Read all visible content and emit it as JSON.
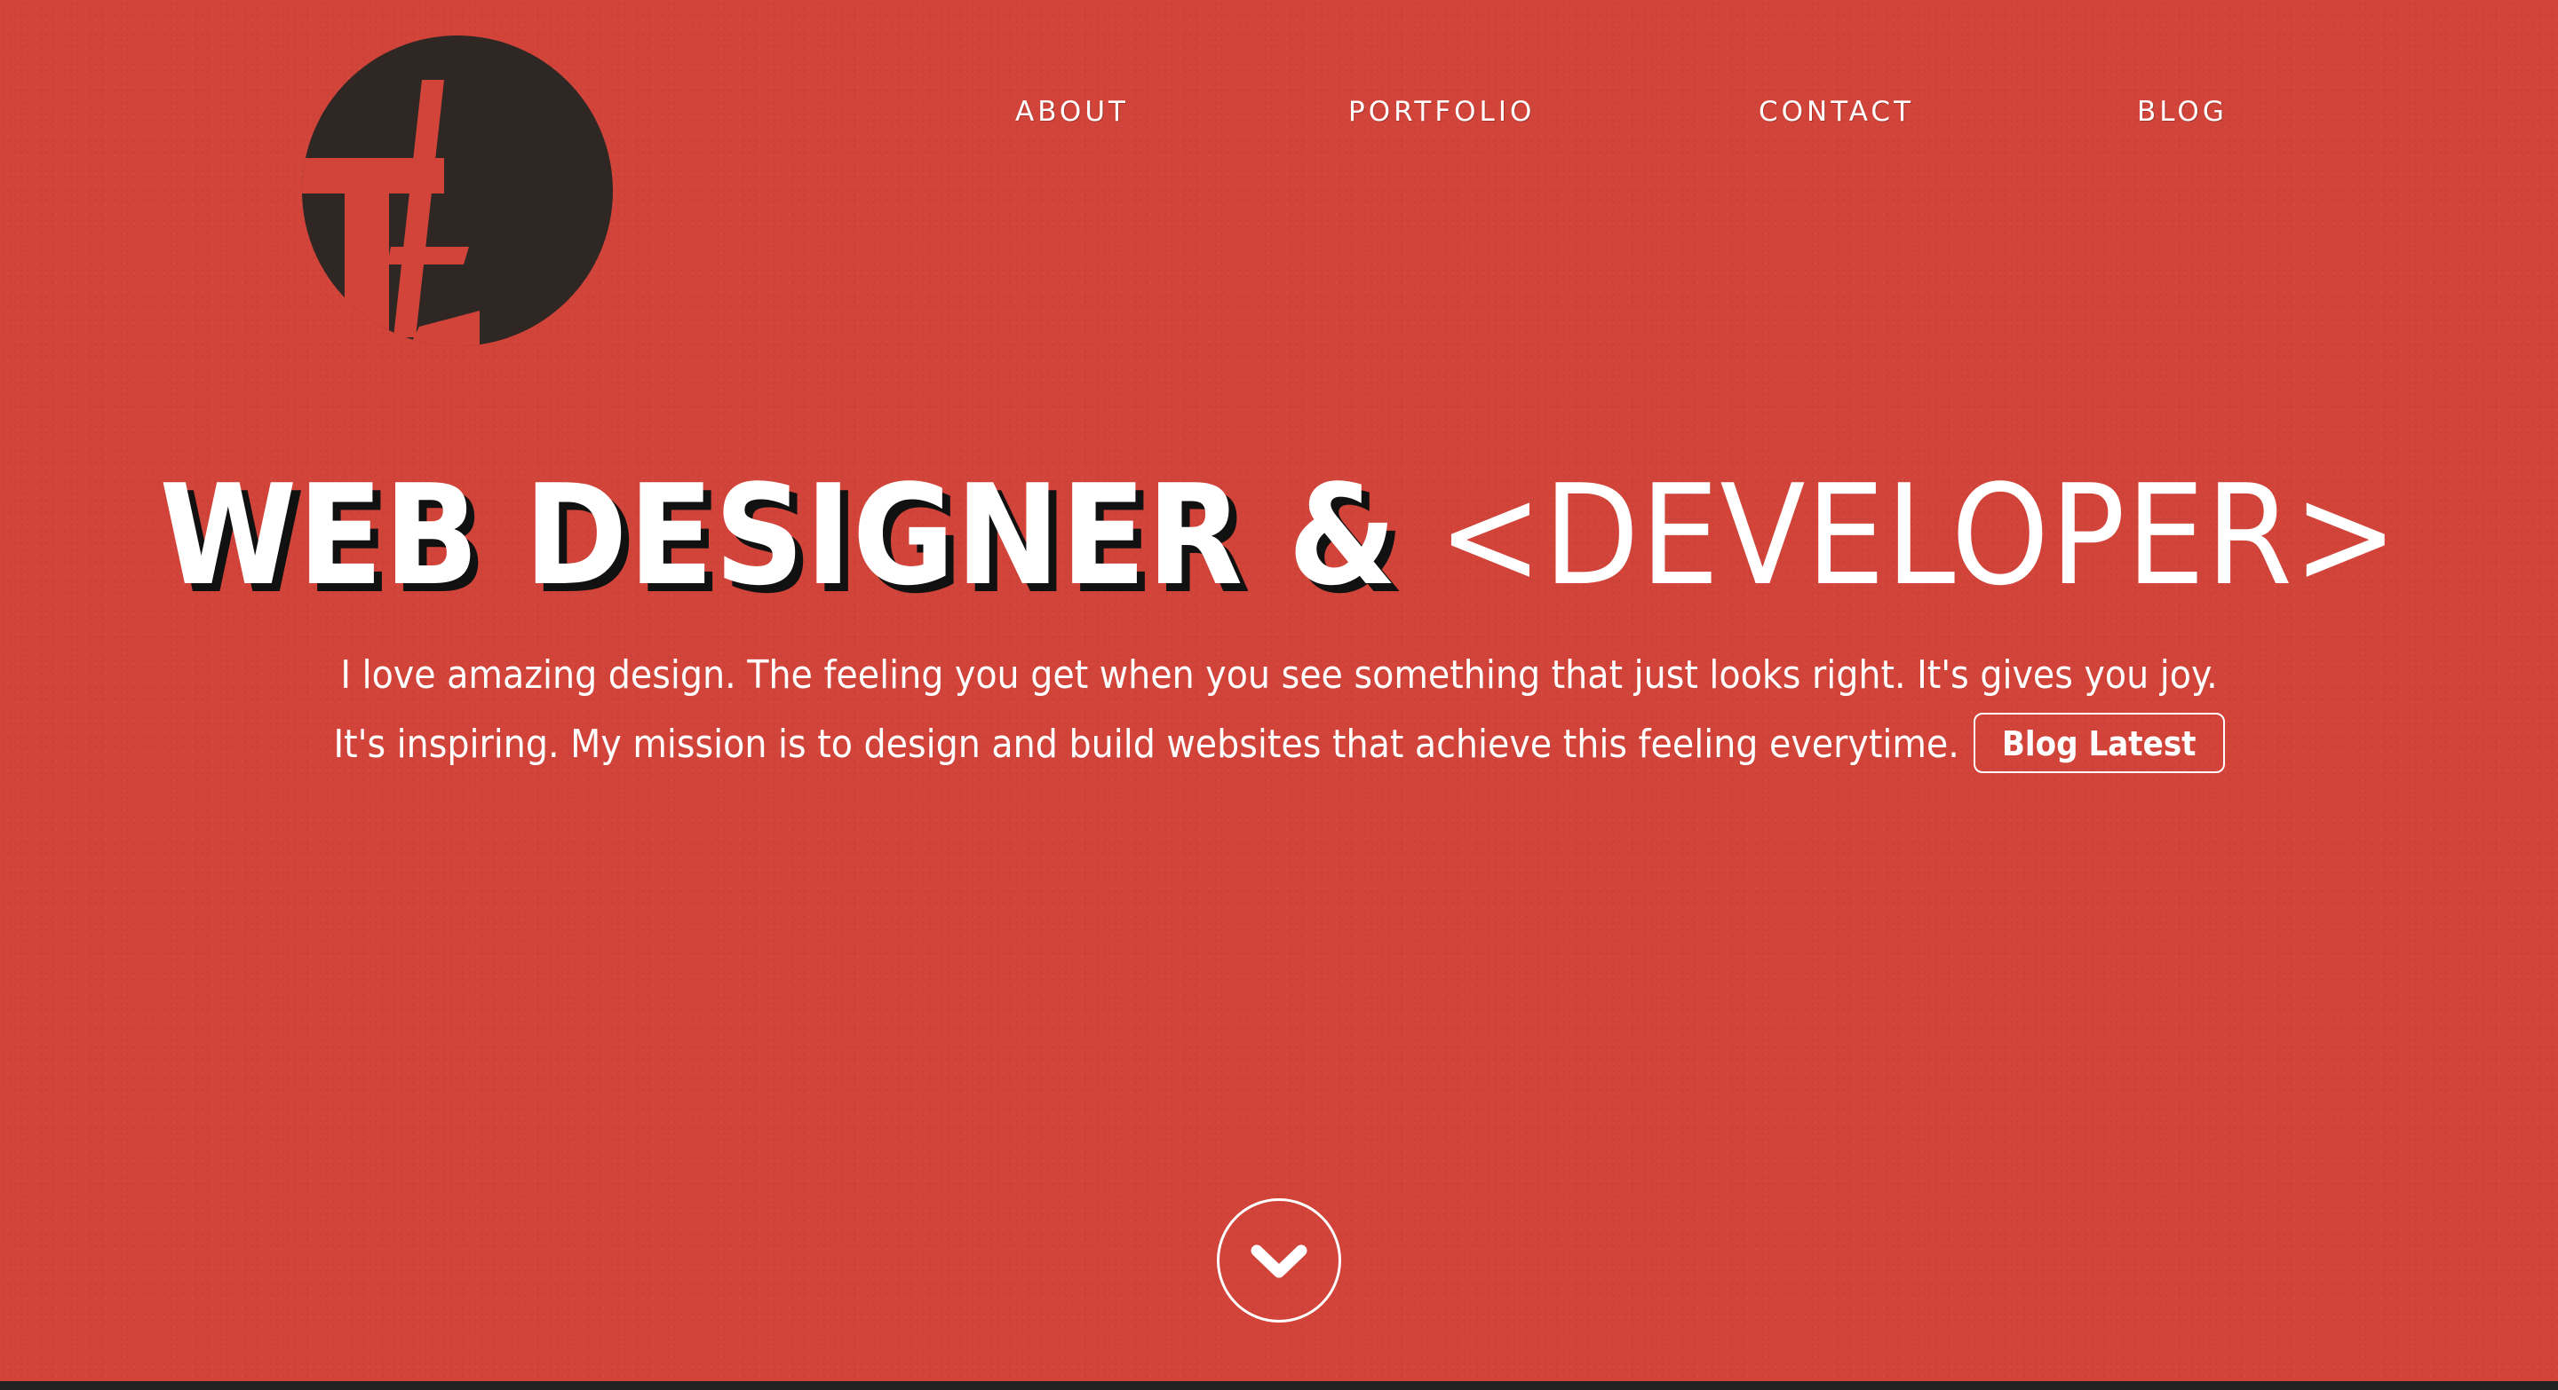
{
  "nav": {
    "items": [
      {
        "label": "ABOUT"
      },
      {
        "label": "PORTFOLIO"
      },
      {
        "label": "CONTACT"
      },
      {
        "label": "BLOG"
      }
    ]
  },
  "hero": {
    "title_part1": "WEB DESIGNER &",
    "title_part2": "<DEVELOPER>",
    "text": "I love amazing design.  The feeling you get when you see something that just looks right.  It's gives you joy.  It's inspiring.  My mission is to design and build websites that achieve this feeling everytime.",
    "button_label": "Blog Latest"
  },
  "icons": {
    "logo": "circle-logo-tt",
    "scroll": "chevron-down-circle-icon"
  },
  "colors": {
    "background": "#d2443a",
    "logo": "#2e2723",
    "text": "#ffffff",
    "title_shadow": "#111111"
  }
}
